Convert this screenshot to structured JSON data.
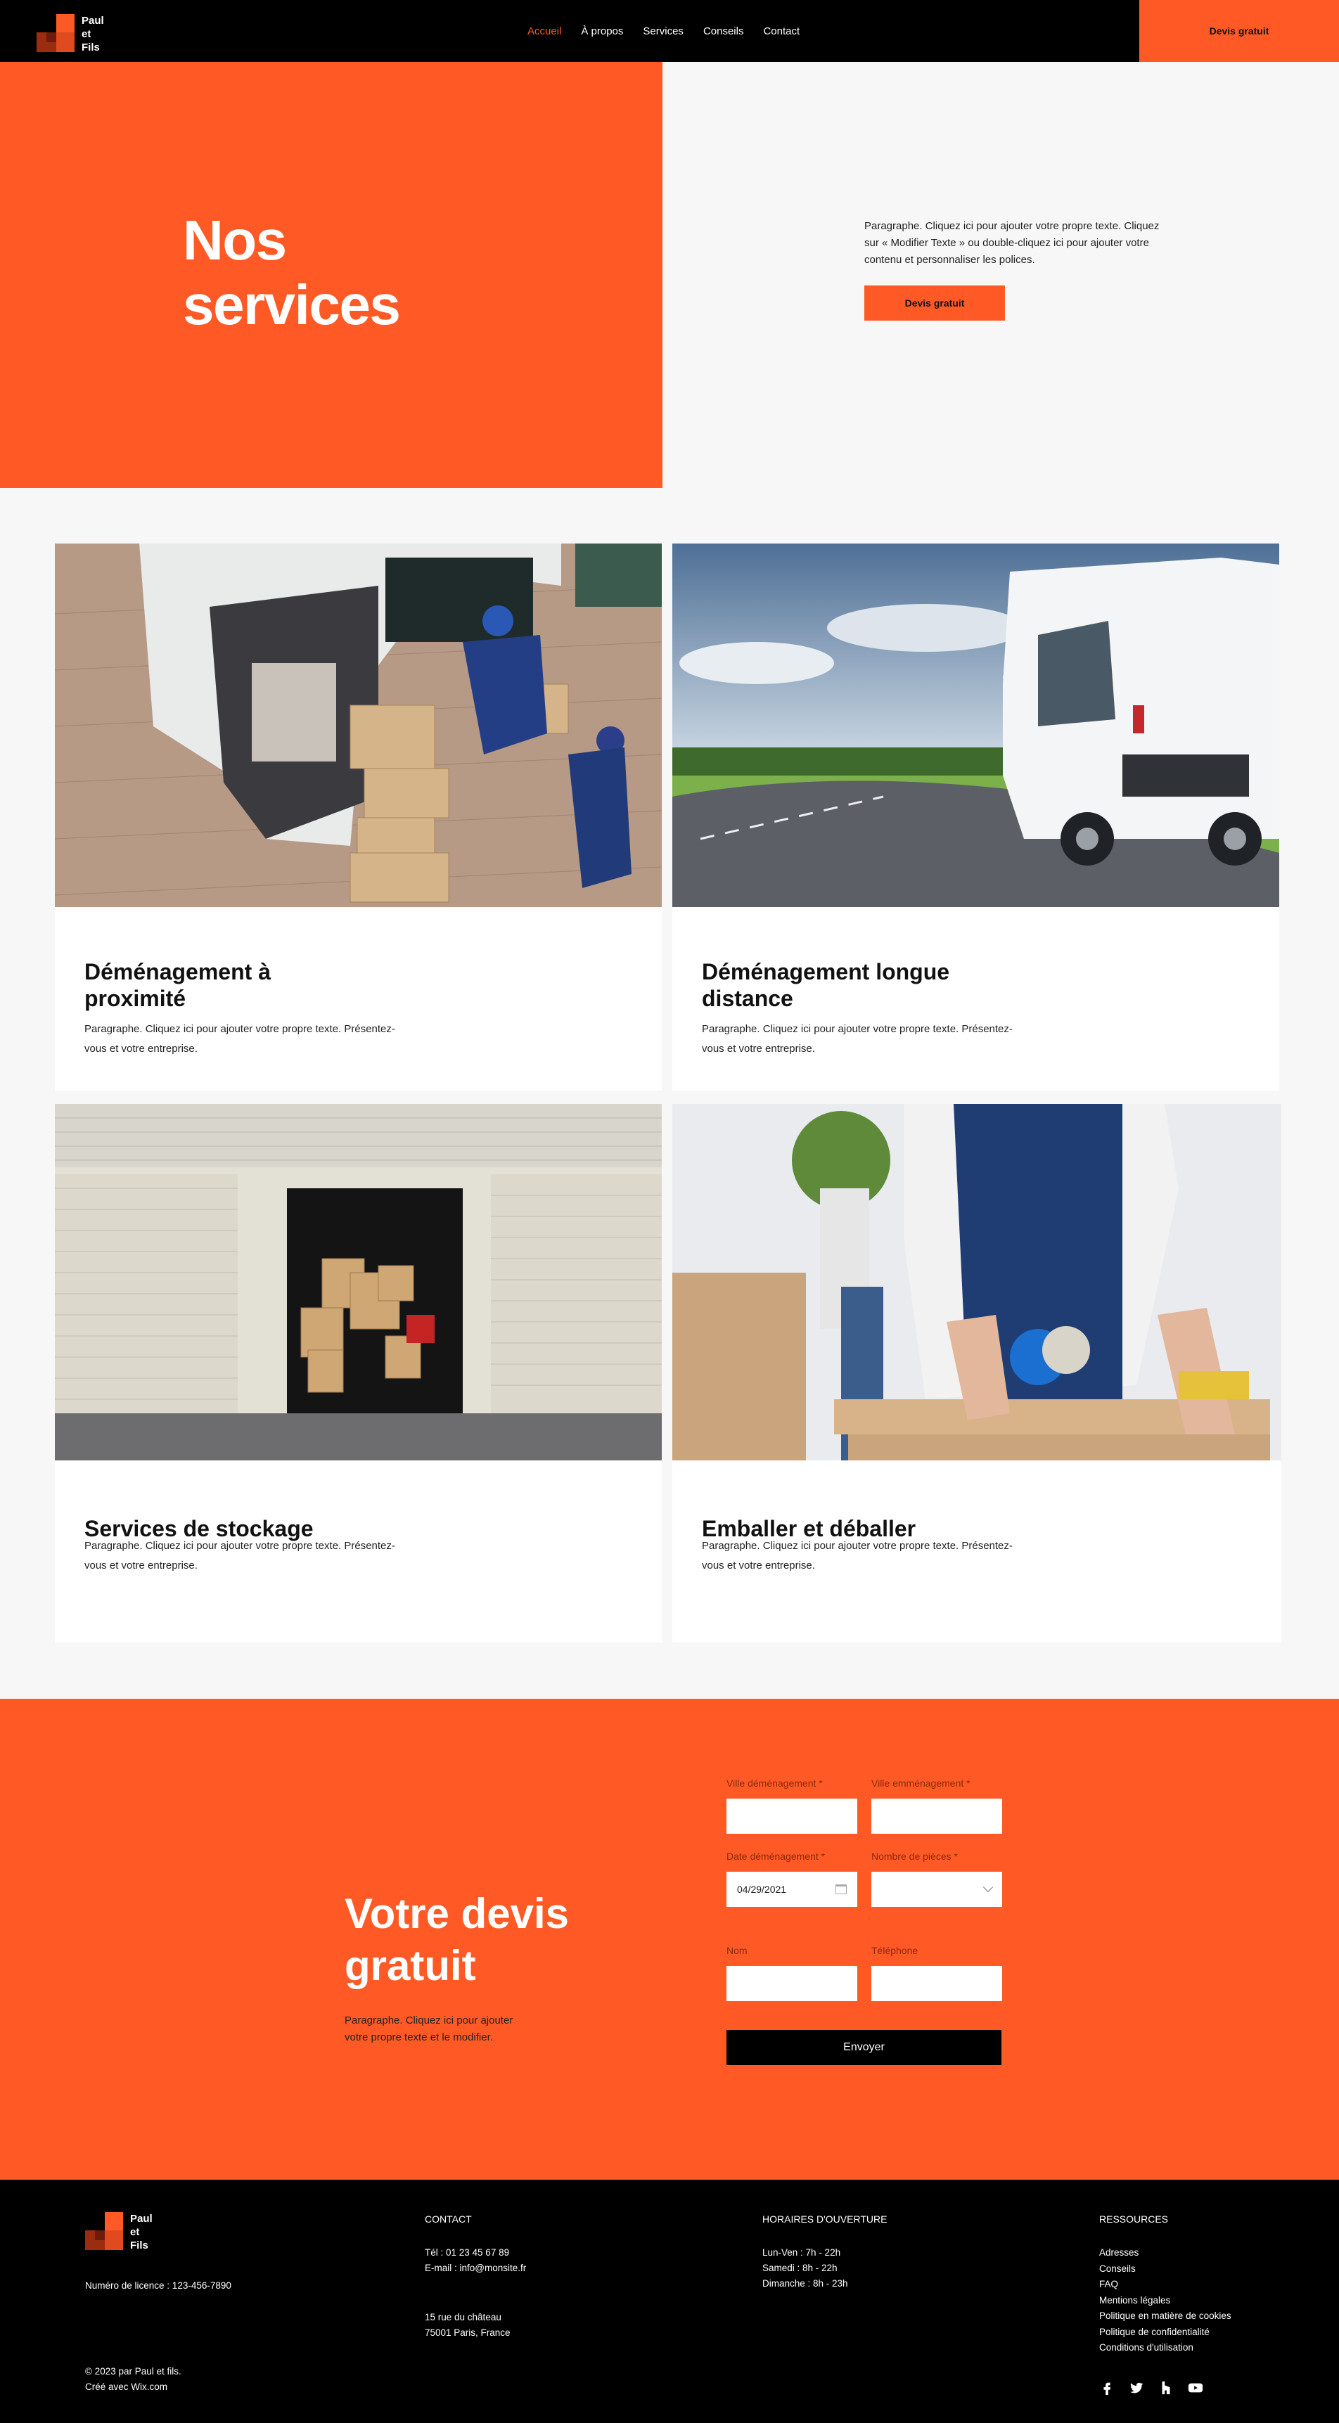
{
  "header": {
    "logo_text": "Paul\net\nFils",
    "nav": [
      {
        "label": "Accueil",
        "active": true
      },
      {
        "label": "À propos",
        "active": false
      },
      {
        "label": "Services",
        "active": false
      },
      {
        "label": "Conseils",
        "active": false
      },
      {
        "label": "Contact",
        "active": false
      }
    ],
    "cta_label": "Devis gratuit"
  },
  "hero": {
    "title": "Nos\nservices",
    "paragraph": "Paragraphe. Cliquez ici pour ajouter votre propre texte. Cliquez sur  « Modifier Texte » ou double-cliquez ici pour ajouter votre contenu et personnaliser les polices.",
    "button_label": "Devis gratuit"
  },
  "services": [
    {
      "title": "Déménagement à\nproximité",
      "description": "Paragraphe. Cliquez ici pour ajouter votre propre texte. Présentez-vous et votre entreprise.",
      "image": "movers-loading-van-photo"
    },
    {
      "title": "Déménagement longue\ndistance",
      "description": "Paragraphe. Cliquez ici pour ajouter votre propre texte. Présentez-vous et votre entreprise.",
      "image": "white-van-on-road-photo"
    },
    {
      "title": "Services de stockage",
      "description": "Paragraphe. Cliquez ici pour ajouter votre propre texte. Présentez-vous et votre entreprise.",
      "image": "storage-units-photo"
    },
    {
      "title": "Emballer et déballer",
      "description": "Paragraphe. Cliquez ici pour ajouter votre propre texte. Présentez-vous et votre entreprise.",
      "image": "packing-box-tape-photo"
    }
  ],
  "quote": {
    "title": "Votre devis\ngratuit",
    "paragraph": "Paragraphe. Cliquez ici pour ajouter votre propre texte et le modifier.",
    "fields": {
      "ville_demenagement": {
        "label": "Ville déménagement *",
        "value": ""
      },
      "ville_emmenagement": {
        "label": "Ville emménagement *",
        "value": ""
      },
      "date_demenagement": {
        "label": "Date déménagement *",
        "value": "04/29/2021"
      },
      "nombre_pieces": {
        "label": "Nombre de pièces *",
        "value": ""
      },
      "nom": {
        "label": "Nom",
        "value": ""
      },
      "telephone": {
        "label": "Téléphone",
        "value": ""
      }
    },
    "submit_label": "Envoyer"
  },
  "footer": {
    "logo_text": "Paul\net\nFils",
    "licence": "Numéro de licence : 123-456-7890",
    "copyright": "© 2023 par Paul et fils.\nCréé avec Wix.com",
    "contact_heading": "CONTACT",
    "contact_lines": "Tél : 01 23 45 67 89\nE-mail : info@monsite.fr",
    "address": "15 rue du château\n75001 Paris, France",
    "hours_heading": "HORAIRES D'OUVERTURE",
    "hours": "Lun-Ven : 7h - 22h\nSamedi : 8h - 22h\nDimanche : 8h - 23h",
    "resources_heading": "RESSOURCES",
    "resources": [
      "Adresses",
      "Conseils",
      "FAQ",
      "Mentions légales",
      "Politique en matière de cookies",
      "Politique de confidentialité",
      "Conditions d'utilisation"
    ],
    "social_icons": [
      "facebook-icon",
      "twitter-icon",
      "houzz-icon",
      "youtube-icon"
    ]
  },
  "colors": {
    "accent": "#ff5a26",
    "dark": "#000000",
    "light_bg": "#f7f7f7"
  }
}
